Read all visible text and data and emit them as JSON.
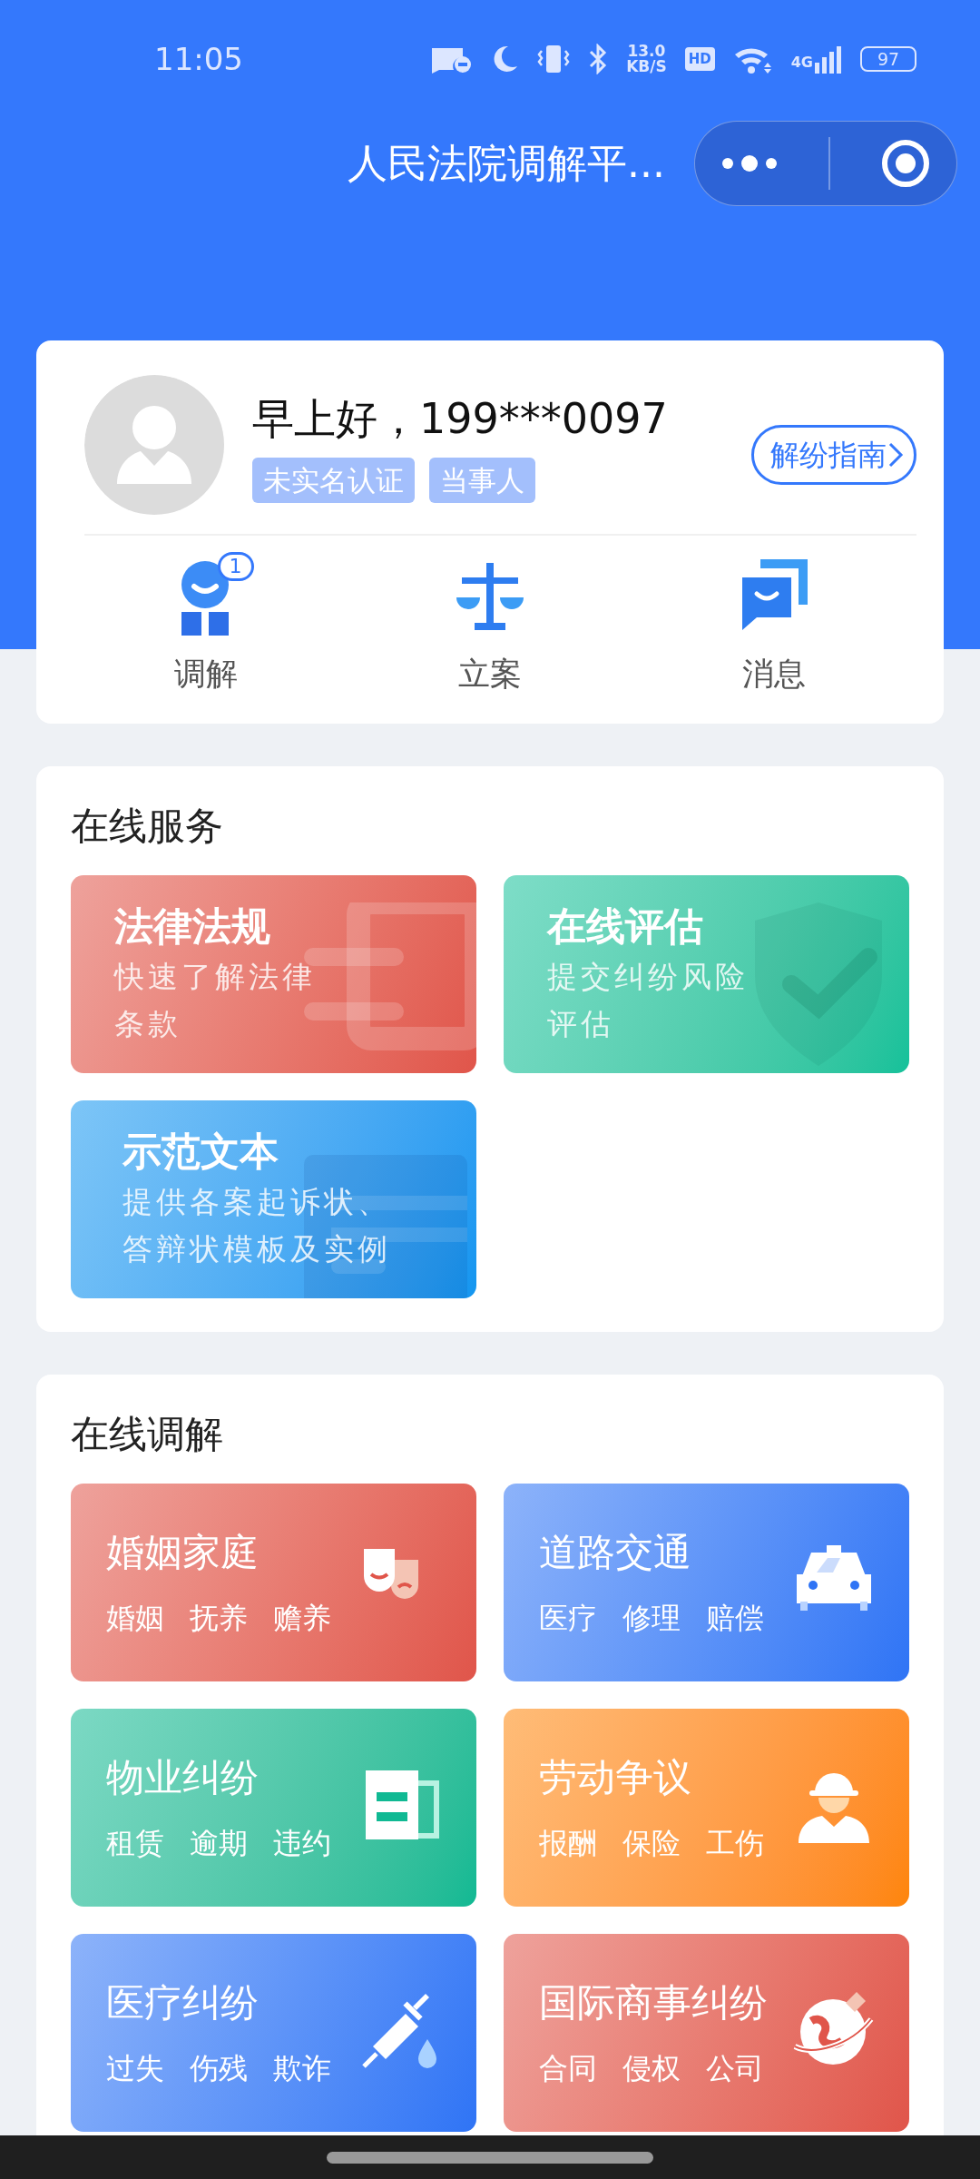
{
  "status_bar": {
    "time": "11:05",
    "speed": "13.0",
    "speed_unit": "KB/S",
    "hd": "HD",
    "network": "4G",
    "battery": "97"
  },
  "title_bar": {
    "title": "人民法院调解平..."
  },
  "profile": {
    "greeting": "早上好，199***0097",
    "tags": [
      "未实名认证",
      "当事人"
    ],
    "guide_button": "解纷指南"
  },
  "shortcuts": [
    {
      "label": "调解",
      "kind": "mediate",
      "badge": "1"
    },
    {
      "label": "立案",
      "kind": "scale"
    },
    {
      "label": "消息",
      "kind": "message"
    }
  ],
  "online_services": {
    "title": "在线服务",
    "cards": [
      {
        "title": "法律法规",
        "desc": "快速了解法律条款",
        "kind": "law",
        "color": "#e0554a"
      },
      {
        "title": "在线评估",
        "desc": "提交纠纷风险评估",
        "kind": "shield",
        "color": "#14c19a"
      },
      {
        "title": "示范文本",
        "desc": "提供各案起诉状、答辩状模板及实例",
        "kind": "document",
        "color": "#1296f0"
      }
    ]
  },
  "online_mediation": {
    "title": "在线调解",
    "cards": [
      {
        "title": "婚姻家庭",
        "tags": [
          "婚姻",
          "抚养",
          "赡养"
        ],
        "kind": "masks",
        "color": "#e0554a"
      },
      {
        "title": "道路交通",
        "tags": [
          "医疗",
          "修理",
          "赔偿"
        ],
        "kind": "taxi",
        "color": "#2f74f5"
      },
      {
        "title": "物业纠纷",
        "tags": [
          "租赁",
          "逾期",
          "违约"
        ],
        "kind": "building",
        "color": "#10b993"
      },
      {
        "title": "劳动争议",
        "tags": [
          "报酬",
          "保险",
          "工伤"
        ],
        "kind": "worker",
        "color": "#fe8508"
      },
      {
        "title": "医疗纠纷",
        "tags": [
          "过失",
          "伤残",
          "欺诈"
        ],
        "kind": "syringe",
        "color": "#2f74f5"
      },
      {
        "title": "国际商事纠纷",
        "tags": [
          "合同",
          "侵权",
          "公司"
        ],
        "kind": "globe",
        "color": "#e0554a"
      }
    ]
  }
}
